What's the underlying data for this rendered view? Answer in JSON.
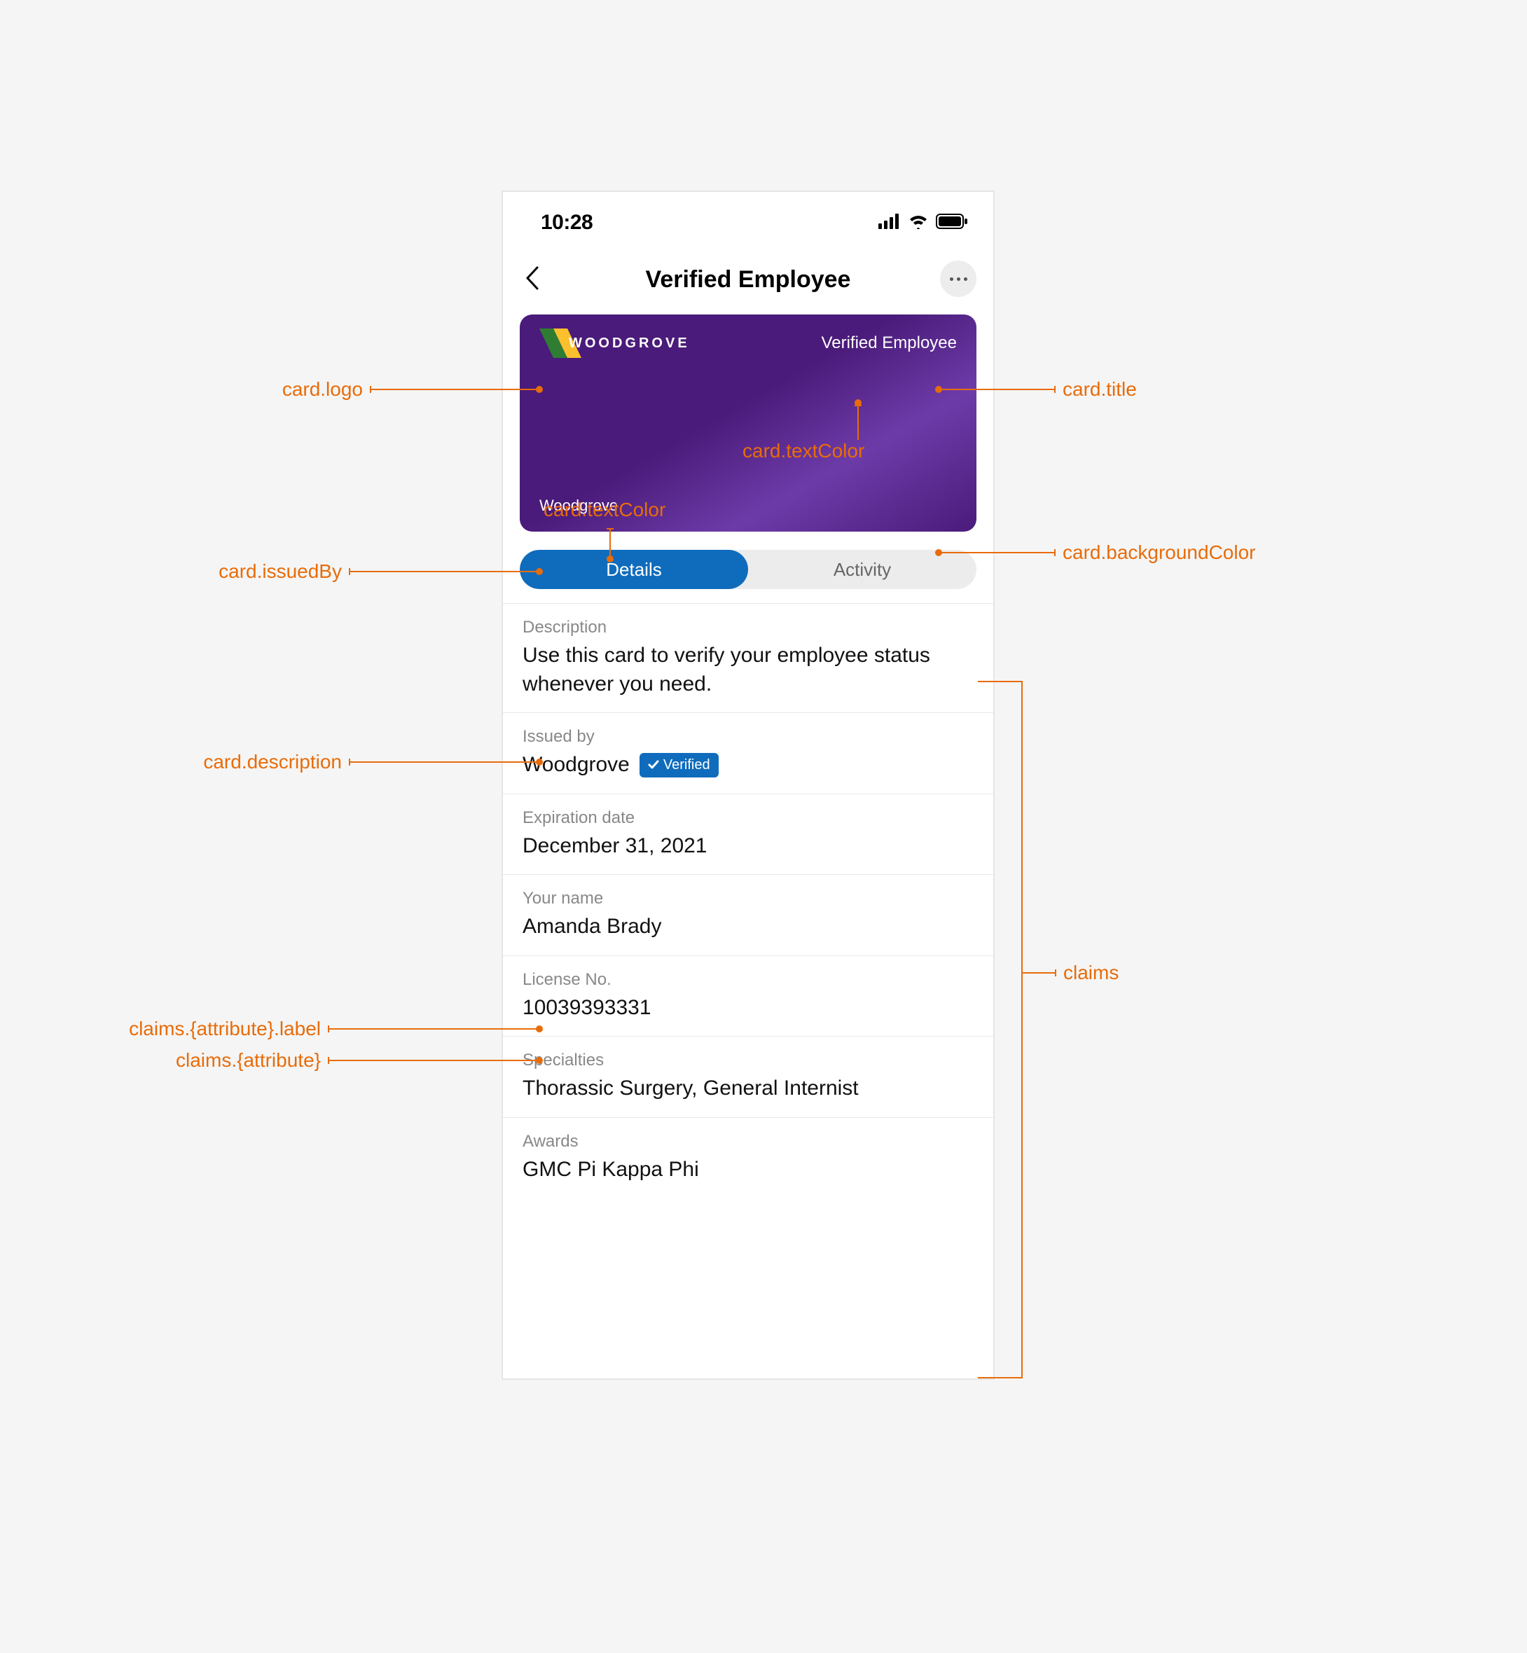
{
  "statusbar": {
    "time": "10:28"
  },
  "nav": {
    "title": "Verified Employee"
  },
  "card": {
    "logoText": "WOODGROVE",
    "title": "Verified Employee",
    "issuedBy": "Woodgrove"
  },
  "tabs": {
    "details": "Details",
    "activity": "Activity"
  },
  "rows": {
    "description": {
      "label": "Description",
      "value": "Use this card to verify your employee status whenever you need."
    },
    "issuedBy": {
      "label": "Issued by",
      "value": "Woodgrove",
      "badge": "Verified"
    },
    "expiration": {
      "label": "Expiration date",
      "value": "December 31, 2021"
    },
    "name": {
      "label": "Your name",
      "value": "Amanda Brady"
    },
    "license": {
      "label": "License No.",
      "value": "10039393331"
    },
    "specialties": {
      "label": "Specialties",
      "value": "Thorassic Surgery, General Internist"
    },
    "awards": {
      "label": "Awards",
      "value": "GMC Pi Kappa Phi"
    }
  },
  "annotations": {
    "cardLogo": "card.logo",
    "cardTitle": "card.title",
    "cardTextColor": "card.textColor",
    "cardBackground": "card.backgroundColor",
    "cardIssuedBy": "card.issuedBy",
    "cardDescription": "card.description",
    "claimsLabel": "claims.{attribute}.label",
    "claimsAttr": "claims.{attribute}",
    "claims": "claims"
  }
}
